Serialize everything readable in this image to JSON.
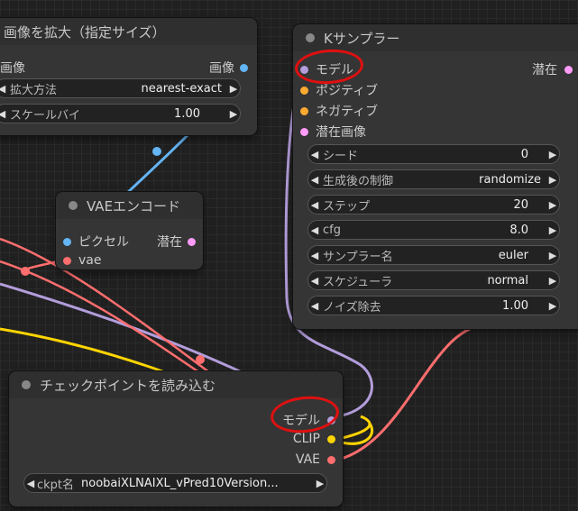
{
  "colors": {
    "model": "#b39ddb",
    "clip": "#ffd500",
    "vae": "#ff6e6e",
    "latent": "#ff9cf9",
    "image": "#64b5f6",
    "conditioning": "#ffa931"
  },
  "upscale_node": {
    "title": "画像を拡大（指定サイズ）",
    "input_label": "画像",
    "output_label": "画像",
    "widgets": [
      {
        "label": "拡大方法",
        "value": "nearest-exact"
      },
      {
        "label": "スケールバイ",
        "value": "1.00"
      }
    ]
  },
  "vae_encode_node": {
    "title": "VAEエンコード",
    "inputs": [
      "ピクセル",
      "vae"
    ],
    "output_label": "潜在"
  },
  "ksampler_node": {
    "title": "Kサンプラー",
    "inputs": [
      "モデル",
      "ポジティブ",
      "ネガティブ",
      "潜在画像"
    ],
    "output_label": "潜在",
    "widgets": [
      {
        "label": "シード",
        "value": "0"
      },
      {
        "label": "生成後の制御",
        "value": "randomize"
      },
      {
        "label": "ステップ",
        "value": "20"
      },
      {
        "label": "cfg",
        "value": "8.0"
      },
      {
        "label": "サンプラー名",
        "value": "euler"
      },
      {
        "label": "スケジューラ",
        "value": "normal"
      },
      {
        "label": "ノイズ除去",
        "value": "1.00"
      }
    ]
  },
  "checkpoint_node": {
    "title": "チェックポイントを読み込む",
    "outputs": [
      "モデル",
      "CLIP",
      "VAE"
    ],
    "widgets": [
      {
        "label": "ckpt名",
        "value": "noobaiXLNAIXL_vPred10Version..."
      }
    ]
  }
}
